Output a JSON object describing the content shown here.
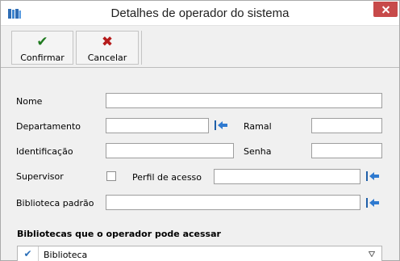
{
  "window": {
    "title": "Detalhes de operador do sistema",
    "icons": {
      "app": "library-books-icon",
      "close": "close-icon"
    }
  },
  "toolbar": {
    "confirm": {
      "label": "Confirmar",
      "icon": "checkmark-icon",
      "color": "#1f7a1f"
    },
    "cancel": {
      "label": "Cancelar",
      "icon": "x-cross-icon",
      "color": "#b51b1b"
    }
  },
  "form": {
    "nome": {
      "label": "Nome",
      "value": ""
    },
    "departamento": {
      "label": "Departamento",
      "value": "",
      "lookup_icon": "arrow-return-icon"
    },
    "ramal": {
      "label": "Ramal",
      "value": ""
    },
    "identificacao": {
      "label": "Identificação",
      "value": ""
    },
    "senha": {
      "label": "Senha",
      "value": ""
    },
    "supervisor": {
      "label": "Supervisor",
      "checked": false
    },
    "perfil": {
      "label": "Perfil de acesso",
      "value": "",
      "lookup_icon": "arrow-return-icon"
    },
    "biblioteca": {
      "label": "Biblioteca padrão",
      "value": "",
      "lookup_icon": "arrow-return-icon"
    }
  },
  "libraries": {
    "title": "Bibliotecas que o operador pode acessar",
    "columns": [
      "Biblioteca"
    ],
    "check_icon": "checkmark-icon",
    "filter_icon": "filter-icon",
    "accent": "#2a6fb8"
  }
}
